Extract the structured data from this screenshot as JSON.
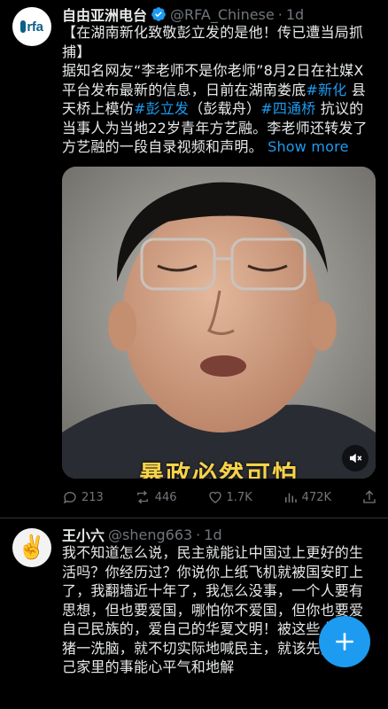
{
  "tweet": {
    "author_name": "自由亚洲电台",
    "handle": "@RFA_Chinese",
    "separator": "·",
    "time": "1d",
    "avatar_label": "rfa",
    "text_segments": [
      {
        "t": "【在湖南新化致敬彭立发的是他！传已遭当局抓捕】",
        "type": "text"
      },
      {
        "t": "\n",
        "type": "br"
      },
      {
        "t": "据知名网友“李老师不是你老师”8月2日在社媒X平台发布最新的信息，日前在湖南娄底",
        "type": "text"
      },
      {
        "t": "#新化",
        "type": "hashtag"
      },
      {
        "t": " 县天桥上模仿",
        "type": "text"
      },
      {
        "t": "#彭立发",
        "type": "hashtag"
      },
      {
        "t": "（彭载舟）",
        "type": "text"
      },
      {
        "t": "#四通桥",
        "type": "hashtag"
      },
      {
        "t": " 抗议的当事人为当地22岁青年方艺融。李老师还转发了方艺融的一段自录视频和声明。",
        "type": "text"
      }
    ],
    "show_more": "Show more",
    "video_caption": "暴政必然可怕",
    "actions": {
      "replies": "213",
      "reposts": "446",
      "likes": "1.7K",
      "views": "472K"
    }
  },
  "reply": {
    "author_name": "王小六",
    "handle": "@sheng663",
    "separator": "·",
    "time": "1d",
    "avatar_emoji": "✌️",
    "text": "我不知道怎么说，民主就能让中国过上更好的生活吗？你经历过？你说你上纸飞机就被国安盯上了，我翻墙近十年了，我怎么没事，一个人要有思想，但也要爱国，哪怕你不爱国，但你也要爱自己民族的，爱自己的华夏文明！被这些人养殖猪一洗脑，就不切实际地喊民主，就该先把你自己家里的事能心平气和地解"
  },
  "fab": {
    "icon": "plus-icon"
  },
  "colors": {
    "accent": "#1d9bf0",
    "muted": "#71767b",
    "text": "#e7e9ea",
    "background": "#000000"
  }
}
